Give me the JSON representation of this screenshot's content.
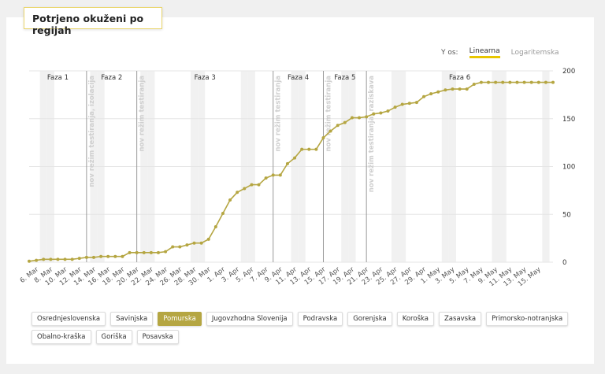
{
  "title": "Potrjeno okuženi po regijah",
  "y_axis_toggle": {
    "label": "Y os:",
    "options": [
      "Linearna",
      "Logaritemska"
    ],
    "selected": "Linearna"
  },
  "colors": {
    "line": "#b5a642",
    "active_region": "#b5a642",
    "toggle_underline": "#e8c600",
    "title_border": "#ead66d"
  },
  "regions": [
    "Osrednjeslovenska",
    "Savinjska",
    "Pomurska",
    "Jugovzhodna Slovenija",
    "Podravska",
    "Gorenjska",
    "Koroška",
    "Zasavska",
    "Primorsko-notranjska",
    "Obalno-kraška",
    "Goriška",
    "Posavska"
  ],
  "selected_region": "Pomurska",
  "chart_data": {
    "type": "line",
    "series": [
      {
        "values": [
          1,
          2,
          3,
          3,
          3,
          3,
          3,
          4,
          5,
          5,
          6,
          6,
          6,
          6,
          10,
          10,
          10,
          10,
          10,
          11,
          16,
          16,
          18,
          20,
          20,
          24,
          37,
          51,
          65,
          73,
          77,
          81,
          81,
          88,
          91,
          91,
          103,
          109,
          118,
          118,
          118,
          130,
          137,
          143,
          146,
          151,
          151,
          152,
          155,
          156,
          158,
          162,
          165,
          166,
          167,
          173,
          176,
          178,
          180,
          181,
          181,
          181,
          186,
          188,
          188,
          188,
          188,
          188,
          188,
          188,
          188,
          188,
          188,
          188
        ]
      }
    ],
    "x_start": "5. Mar",
    "x_end": "17. May",
    "x_tick_labels": [
      "6. Mar",
      "8. Mar",
      "10. Mar",
      "12. Mar",
      "14. Mar",
      "16. Mar",
      "18. Mar",
      "20. Mar",
      "22. Mar",
      "24. Mar",
      "26. Mar",
      "28. Mar",
      "30. Mar",
      "1. Apr",
      "3. Apr",
      "5. Apr",
      "7. Apr",
      "9. Apr",
      "11. Apr",
      "13. Apr",
      "15. Apr",
      "17. Apr",
      "19. Apr",
      "21. Apr",
      "23. Apr",
      "25. Apr",
      "27. Apr",
      "29. Apr",
      "1. May",
      "3. May",
      "5. May",
      "7. May",
      "9. May",
      "11. May",
      "13. May",
      "15. May"
    ],
    "y_ticks": [
      0,
      50,
      100,
      150,
      200
    ],
    "ylim": [
      0,
      200
    ],
    "phases": [
      {
        "label": "Faza 1",
        "start": "5. Mar",
        "end": "13. Mar"
      },
      {
        "label": "Faza 2",
        "start": "13. Mar",
        "end": "20. Mar"
      },
      {
        "label": "Faza 3",
        "start": "20. Mar",
        "end": "8. Apr"
      },
      {
        "label": "Faza 4",
        "start": "8. Apr",
        "end": "15. Apr"
      },
      {
        "label": "Faza 5",
        "start": "15. Apr",
        "end": "21. Apr"
      },
      {
        "label": "Faza 6",
        "start": "21. Apr",
        "end": "17. May"
      }
    ],
    "annotations": [
      {
        "date": "13. Mar",
        "text": "nov režim testiranja, izolacija"
      },
      {
        "date": "20. Mar",
        "text": "nov režim testiranja"
      },
      {
        "date": "8. Apr",
        "text": "nov režim testiranja"
      },
      {
        "date": "15. Apr",
        "text": "nov režim testiranja"
      },
      {
        "date": "21. Apr",
        "text": "nov režim testiranja, raziskava"
      }
    ],
    "weekend_shading": true,
    "grid": true
  }
}
